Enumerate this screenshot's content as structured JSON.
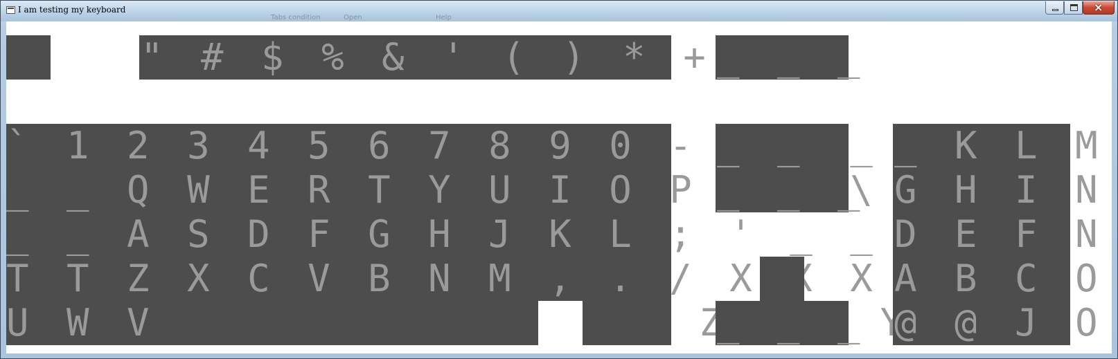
{
  "window": {
    "title": "I am testing my keyboard",
    "menu_ghost": [
      "Tabs condition",
      "Open",
      "Help"
    ]
  },
  "keyboard": {
    "function_row": {
      "left_key": "",
      "symbols": "\" # $ % & ' ( ) * + , -",
      "right_keys": "_ _ _"
    },
    "main_block": {
      "rows": [
        "` 1 2 3 4 5 6 7 8 9 0 - = _ _",
        "_ _ Q W E R T Y U I O P [ ] \\",
        "_ _ A S D F G H J K L ; ' _ _",
        "T T Z X C V B N M , . / X X X",
        "U W V                  Z   \\ Y"
      ]
    },
    "nav_block": {
      "rows": [
        "_ _",
        "_ _ _"
      ]
    },
    "arrow_block": {
      "bottom_row": "_ _ _"
    },
    "numpad": {
      "rows": [
        "_ K L M",
        "G H I N",
        "D E F N",
        "A B C O",
        "@ @ J O"
      ]
    }
  },
  "colors": {
    "key_block": "#4d4d4d",
    "glyph": "#9a9a9a",
    "client_bg": "#ffffff"
  }
}
